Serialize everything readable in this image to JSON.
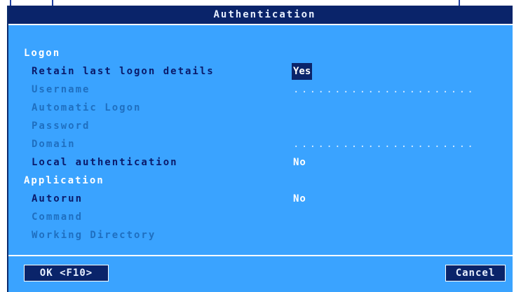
{
  "dialog": {
    "title": "Authentication"
  },
  "sections": {
    "logon": "Logon",
    "application": "Application"
  },
  "fields": {
    "retain_label": "Retain last logon details",
    "retain_value": "Yes",
    "username_label": "Username",
    "username_value": "......................",
    "automatic_logon_label": "Automatic Logon",
    "password_label": "Password",
    "domain_label": "Domain",
    "domain_value": "......................",
    "local_auth_label": "Local authentication",
    "local_auth_value": "No",
    "autorun_label": "Autorun",
    "autorun_value": "No",
    "command_label": "Command",
    "working_dir_label": "Working Directory"
  },
  "buttons": {
    "ok_label": "OK <F10>",
    "cancel_label": "Cancel"
  },
  "colors": {
    "background": "#3aa3ff",
    "titlebar": "#0a246a",
    "active_text": "#0a1a6a",
    "disabled_text": "#1f6fc0",
    "value_text": "#ffffff"
  }
}
